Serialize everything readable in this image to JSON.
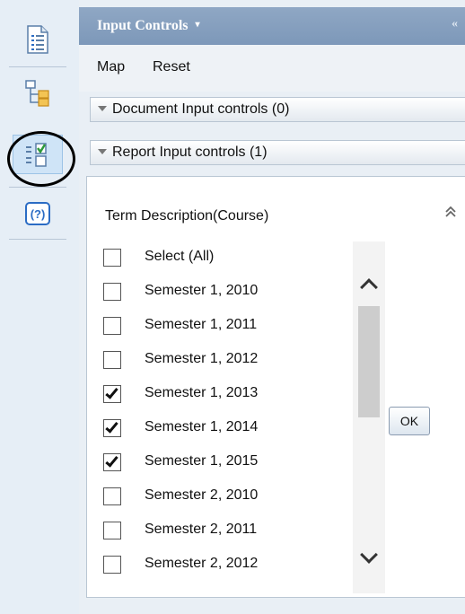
{
  "rail": {
    "items": [
      {
        "icon": "document-icon"
      },
      {
        "icon": "tree-structure-icon"
      },
      {
        "icon": "input-controls-icon",
        "active": true
      },
      {
        "icon": "help-icon",
        "text": "(?)"
      }
    ]
  },
  "panel": {
    "title": "Input Controls",
    "title_caret": "▾",
    "collapse": "«"
  },
  "toolbar": {
    "map_label": "Map",
    "reset_label": "Reset"
  },
  "sections": {
    "document": "Document Input controls (0)",
    "report": "Report Input controls (1)"
  },
  "control": {
    "title": "Term Description(Course)",
    "collapse_glyph": "⌃",
    "items": [
      {
        "label": "Select (All)",
        "checked": false
      },
      {
        "label": "Semester 1, 2010",
        "checked": false
      },
      {
        "label": "Semester 1, 2011",
        "checked": false
      },
      {
        "label": "Semester 1, 2012",
        "checked": false
      },
      {
        "label": "Semester 1, 2013",
        "checked": true
      },
      {
        "label": "Semester 1, 2014",
        "checked": true
      },
      {
        "label": "Semester 1, 2015",
        "checked": true
      },
      {
        "label": "Semester 2, 2010",
        "checked": false
      },
      {
        "label": "Semester 2, 2011",
        "checked": false
      },
      {
        "label": "Semester 2, 2012",
        "checked": false
      }
    ],
    "ok_label": "OK"
  }
}
